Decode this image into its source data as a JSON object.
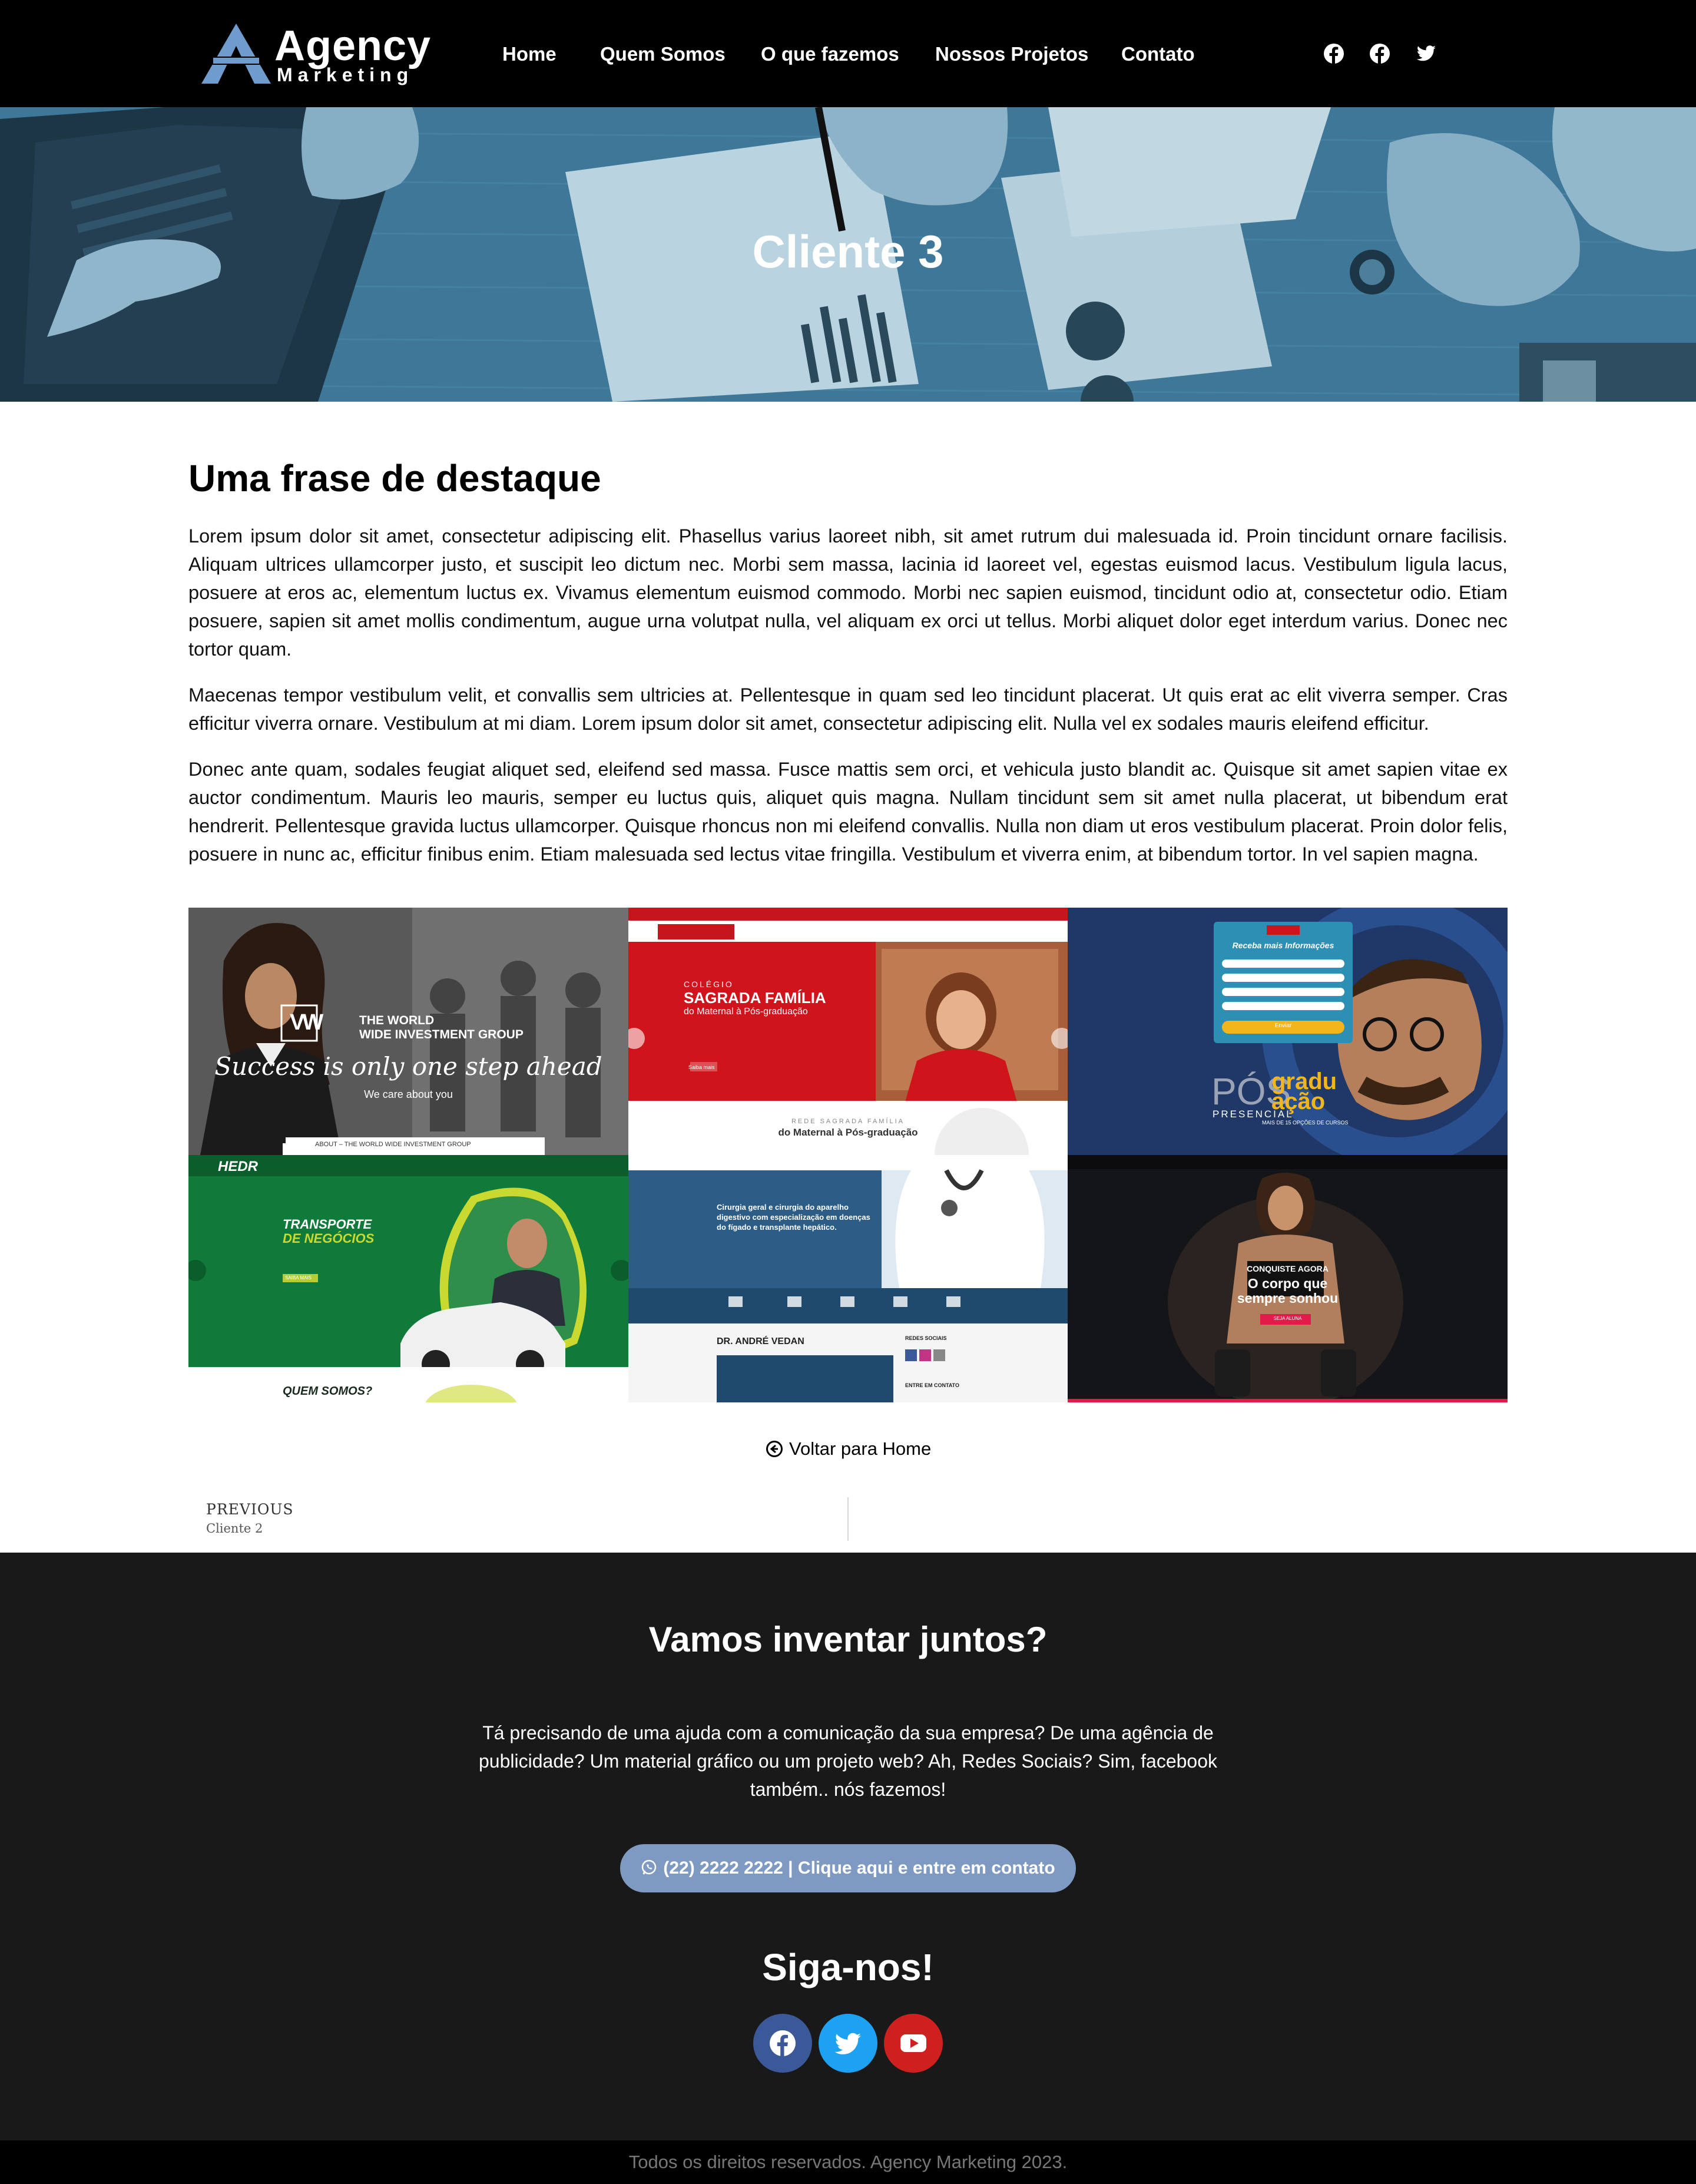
{
  "header": {
    "logo_title": "Agency",
    "logo_subtitle": "Marketing",
    "nav": [
      "Home",
      "Quem Somos",
      "O que fazemos",
      "Nossos Projetos",
      "Contato"
    ],
    "social_icons": [
      "facebook-icon",
      "facebook-icon",
      "twitter-icon"
    ]
  },
  "hero": {
    "title": "Cliente 3"
  },
  "content": {
    "heading": "Uma frase de destaque",
    "paragraphs": [
      "Lorem ipsum dolor sit amet, consectetur adipiscing elit. Phasellus varius laoreet nibh, sit amet rutrum dui malesuada id. Proin tincidunt ornare facilisis. Aliquam ultrices ullamcorper justo, et suscipit leo dictum nec. Morbi sem massa, lacinia id laoreet vel, egestas euismod lacus. Vestibulum ligula lacus, posuere at eros ac, elementum luctus ex. Vivamus elementum euismod commodo. Morbi nec sapien euismod, tincidunt odio at, consectetur odio. Etiam posuere, sapien sit amet mollis condimentum, augue urna volutpat nulla, vel aliquam ex orci ut tellus. Morbi aliquet dolor eget interdum varius. Donec nec tortor quam.",
      "Maecenas tempor vestibulum velit, et convallis sem ultricies at. Pellentesque in quam sed leo tincidunt placerat. Ut quis erat ac elit viverra semper. Cras efficitur viverra ornare. Vestibulum at mi diam. Lorem ipsum dolor sit amet, consectetur adipiscing elit. Nulla vel ex sodales mauris eleifend efficitur.",
      "Donec ante quam, sodales feugiat aliquet sed, eleifend sed massa. Fusce mattis sem orci, et vehicula justo blandit ac. Quisque sit amet sapien vitae ex auctor condimentum. Mauris leo mauris, semper eu luctus quis, aliquet quis magna. Nullam tincidunt sem sit amet nulla placerat, ut bibendum erat hendrerit. Pellentesque gravida luctus ullamcorper. Quisque rhoncus non mi eleifend convallis. Nulla non diam ut eros vestibulum placerat. Proin dolor felis, posuere in nunc ac, efficitur finibus enim. Etiam malesuada sed lectus vitae fringilla. Vestibulum et viverra enim, at bibendum tortor. In vel sapien magna."
    ]
  },
  "gallery": {
    "g1": {
      "title_line1": "THE WORLD",
      "title_line2": "WIDE INVESTMENT GROUP",
      "tagline": "Success is only one step ahead",
      "sub": "We care about you",
      "about": "ABOUT – THE WORLD WIDE INVESTMENT GROUP"
    },
    "g2": {
      "kicker": "COLÉGIO",
      "title": "SAGRADA FAMÍLIA",
      "sub": "do Maternal à Pós-graduação",
      "btn": "Saiba mais",
      "net": "REDE SAGRADA FAMÍLIA",
      "net_sub": "do Maternal à Pós-graduação"
    },
    "g3": {
      "form_title": "Receba mais Informações",
      "form_btn": "Enviar",
      "pos": "PÓS",
      "grad": "gradu",
      "acao": "ação",
      "presencial": "PRESENCIAL",
      "cursos": "MAIS DE 15 OPÇÕES DE CURSOS"
    },
    "g4": {
      "brand": "HEDR",
      "title1": "TRANSPORTE",
      "title2": "DE NEGÓCIOS",
      "btn": "SAIBA MAIS",
      "quem": "QUEM SOMOS?"
    },
    "g5": {
      "headline": "Cirurgia geral e cirurgia do aparelho digestivo com especialização em doenças do fígado e transplante hepático.",
      "doctor": "DR. ANDRÉ VEDAN",
      "redes": "REDES SOCIAIS",
      "contato": "ENTRE EM CONTATO"
    },
    "g6": {
      "kicker": "CONQUISTE AGORA",
      "title1": "O corpo que",
      "title2": "sempre sonhou",
      "btn": "SEJA ALUNA"
    }
  },
  "back_link": "Voltar para Home",
  "post_nav": {
    "previous_label": "PREVIOUS",
    "previous_title": "Cliente 2"
  },
  "footer": {
    "title": "Vamos inventar juntos?",
    "text": "Tá precisando de uma ajuda com a comunicação da sua empresa? De uma agência de publicidade? Um material gráfico ou um projeto web? Ah, Redes Sociais? Sim, facebook também.. nós fazemos!",
    "cta": "(22) 2222 2222 | Clique aqui e entre em contato",
    "follow_title": "Siga-nos!",
    "social": [
      {
        "icon": "facebook-icon",
        "color": "#3b5998"
      },
      {
        "icon": "twitter-icon",
        "color": "#1da1f2"
      },
      {
        "icon": "youtube-icon",
        "color": "#cd201f"
      }
    ]
  },
  "copyright": "Todos os direitos reservados. Agency Marketing 2023.",
  "colors": {
    "header_bg": "#000000",
    "hero_tint": "#3f7a9a",
    "footer_bg": "#191919",
    "cta_bg": "#7f9ac2",
    "logo_blue": "#6f9ccd"
  }
}
